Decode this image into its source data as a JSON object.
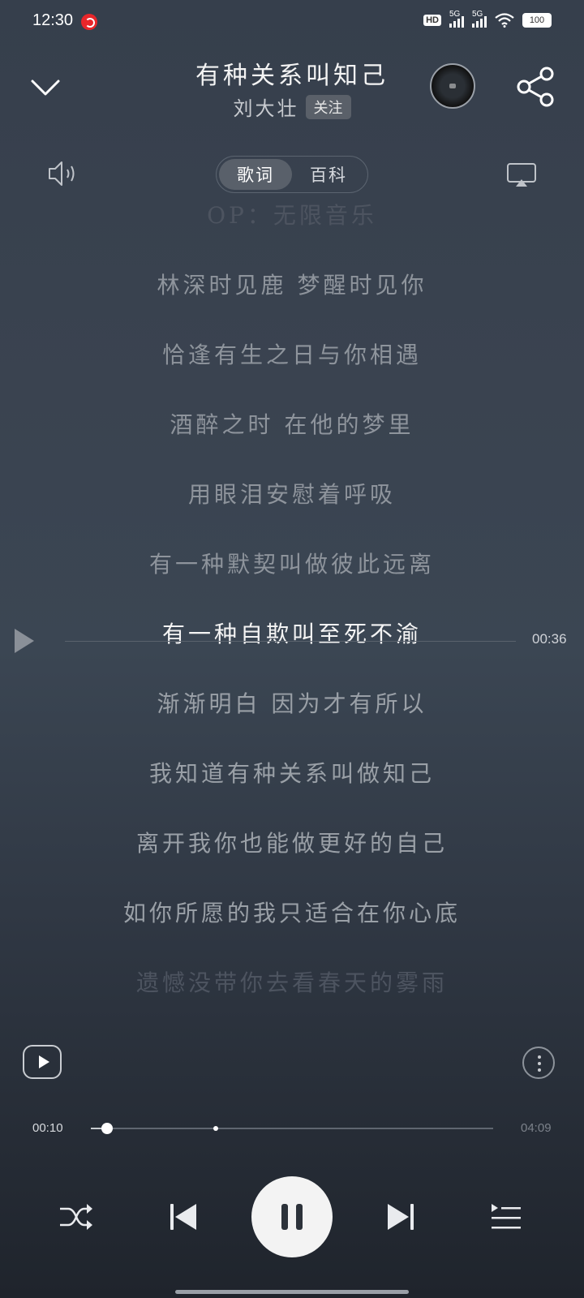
{
  "status": {
    "time": "12:30",
    "hd": "HD",
    "signal1": "5G",
    "signal2": "5G",
    "battery": "100"
  },
  "header": {
    "title": "有种关系叫知己",
    "artist": "刘大壮",
    "follow_label": "关注"
  },
  "tabs": [
    {
      "label": "歌词",
      "active": true
    },
    {
      "label": "百科",
      "active": false
    }
  ],
  "lyrics": [
    "OP：无限音乐",
    "林深时见鹿 梦醒时见你",
    "恰逢有生之日与你相遇",
    "酒醉之时 在他的梦里",
    "用眼泪安慰着呼吸",
    "有一种默契叫做彼此远离",
    "有一种自欺叫至死不渝",
    "渐渐明白 因为才有所以",
    "我知道有种关系叫做知己",
    "离开我你也能做更好的自己",
    "如你所愿的我只适合在你心底",
    "遗憾没带你去看春天的雾雨"
  ],
  "current_lyric_index": 6,
  "seek_time": "00:36",
  "progress": {
    "current": "00:10",
    "total": "04:09",
    "played_fraction": 0.04,
    "buffered_fraction": 0.31
  },
  "colors": {
    "accent": "#f3f3f3",
    "background": "#3a4350"
  }
}
